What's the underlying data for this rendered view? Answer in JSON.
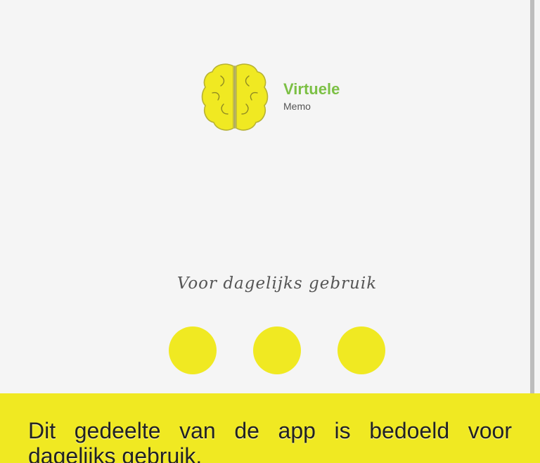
{
  "app": {
    "title": "Virtuele",
    "subtitle": "Memo",
    "logo_icon": "brain-icon"
  },
  "main": {
    "tagline": "Voor dagelijks gebruik",
    "page_indicators": [
      {
        "name": "page-dot-1"
      },
      {
        "name": "page-dot-2"
      },
      {
        "name": "page-dot-3"
      }
    ]
  },
  "banner": {
    "text": "Dit gedeelte van de app is bedoeld voor dagelijks gebruik."
  },
  "colors": {
    "accent_yellow": "#f0e922",
    "brand_green": "#7cc045",
    "background": "#f5f5f5"
  }
}
